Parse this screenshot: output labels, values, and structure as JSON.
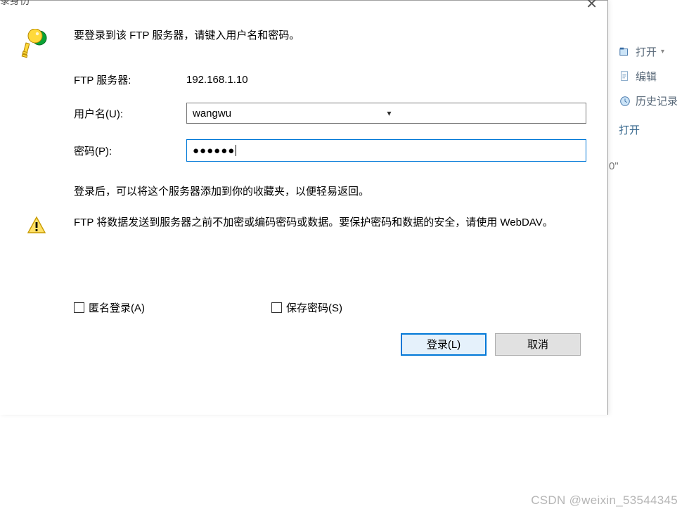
{
  "dialog": {
    "title_fragment": "录身仂",
    "instruction": "要登录到该 FTP 服务器，请键入用户名和密码。",
    "server_label": "FTP 服务器:",
    "server_value": "192.168.1.10",
    "username_label": "用户名(U):",
    "username_value": "wangwu",
    "password_label": "密码(P):",
    "password_value": "●●●●●●",
    "info_text": "登录后，可以将这个服务器添加到你的收藏夹，以便轻易返回。",
    "warning_text": "FTP 将数据发送到服务器之前不加密或编码密码或数据。要保护密码和数据的安全，请使用 WebDAV。",
    "anonymous_label": "匿名登录(A)",
    "save_password_label": "保存密码(S)",
    "login_button": "登录(L)",
    "cancel_button": "取消"
  },
  "side": {
    "open": "打开",
    "edit": "编辑",
    "history": "历史记录",
    "open2": "打开",
    "open_dropdown_suffix": "▾"
  },
  "background_fragment": "0\"",
  "watermark": "CSDN @weixin_53544345"
}
